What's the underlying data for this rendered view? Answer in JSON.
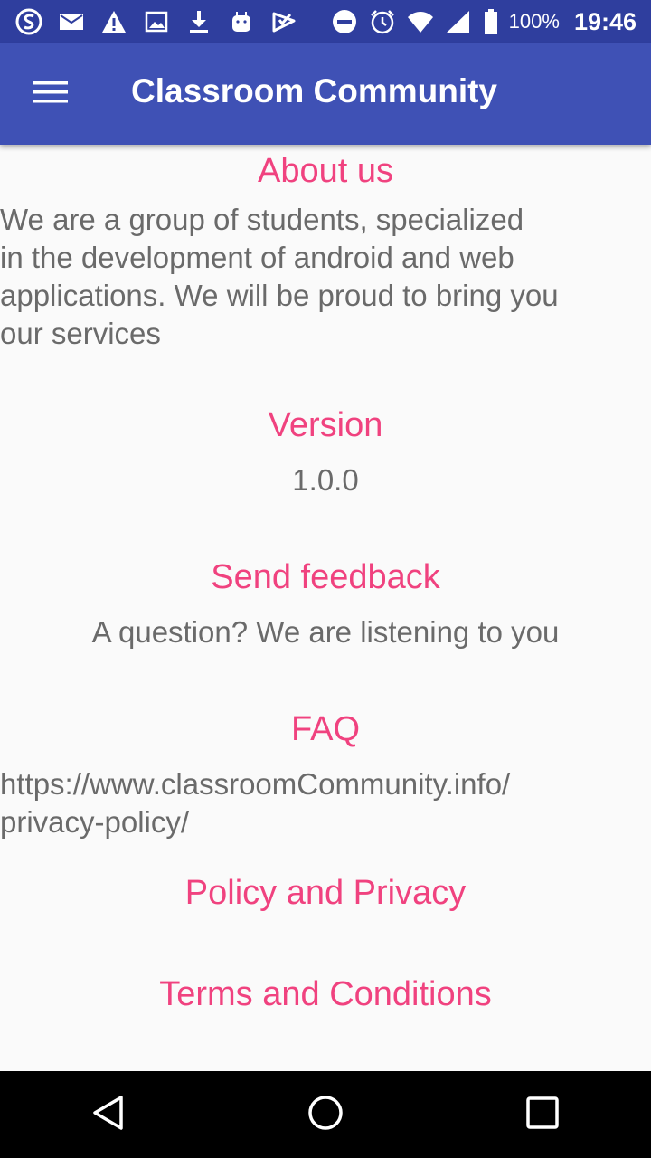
{
  "status_bar": {
    "left_icons": [
      "sync-s-icon",
      "mail-icon",
      "warning-icon",
      "image-icon",
      "download-icon",
      "android-icon",
      "checkbox-icon"
    ],
    "battery_percent": "100%",
    "time": "19:46"
  },
  "app_bar": {
    "title": "Classroom Community"
  },
  "sections": {
    "about": {
      "title": "About us",
      "text": " We are a group of students, specialized\nin the development of android and web\napplications. We will be proud to bring you\nour services"
    },
    "version": {
      "title": "Version",
      "value": "1.0.0"
    },
    "feedback": {
      "title": "Send feedback",
      "text": "A question? We are listening to you"
    },
    "faq": {
      "title": "FAQ",
      "text": "https://www.classroomCommunity.info/\nprivacy-policy/"
    },
    "policy": {
      "title": "Policy and Privacy"
    },
    "terms": {
      "title": "Terms and Conditions"
    }
  },
  "colors": {
    "status_bar": "#2f3e9e",
    "app_bar": "#3f51b5",
    "accent": "#f0427f",
    "body_text": "#6a6a6a",
    "background": "#fafafa"
  }
}
